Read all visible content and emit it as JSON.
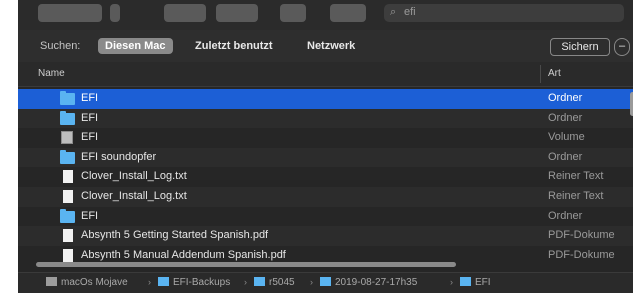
{
  "toolbar": {
    "search_value": "efi",
    "icons": [
      "icon-view-grid",
      "list-view-icon",
      "column-view-icon",
      "gallery-view-icon",
      "group-icon",
      "gear-icon",
      "share-icon",
      "tag-icon",
      "search-icon"
    ]
  },
  "scope": {
    "label": "Suchen:",
    "options": [
      "Diesen Mac",
      "Zuletzt benutzt",
      "Netzwerk"
    ],
    "active": "Diesen Mac",
    "save": "Sichern",
    "minus": "–"
  },
  "columns": {
    "name": "Name",
    "kind": "Art"
  },
  "rows": [
    {
      "name": "EFI",
      "kind": "Ordner",
      "icon": "folder-icon",
      "selected": true
    },
    {
      "name": "EFI",
      "kind": "Ordner",
      "icon": "folder-icon"
    },
    {
      "name": "EFI",
      "kind": "Volume",
      "icon": "volume-icon"
    },
    {
      "name": "EFI soundopfer",
      "kind": "Ordner",
      "icon": "folder-icon"
    },
    {
      "name": "Clover_Install_Log.txt",
      "kind": "Reiner Text",
      "icon": "document-icon"
    },
    {
      "name": "Clover_Install_Log.txt",
      "kind": "Reiner Text",
      "icon": "document-icon"
    },
    {
      "name": "EFI",
      "kind": "Ordner",
      "icon": "folder-icon"
    },
    {
      "name": "Absynth 5 Getting Started Spanish.pdf",
      "kind": "PDF-Dokume",
      "icon": "document-icon"
    },
    {
      "name": "Absynth 5 Manual Addendum Spanish.pdf",
      "kind": "PDF-Dokume",
      "icon": "document-icon"
    }
  ],
  "path": [
    "macOs Mojave",
    "EFI-Backups",
    "r5045",
    "2019-08-27-17h35",
    "EFI"
  ],
  "colors": {
    "selection": "#1c5fd6",
    "folder": "#5ab4f1",
    "background": "#262626"
  }
}
